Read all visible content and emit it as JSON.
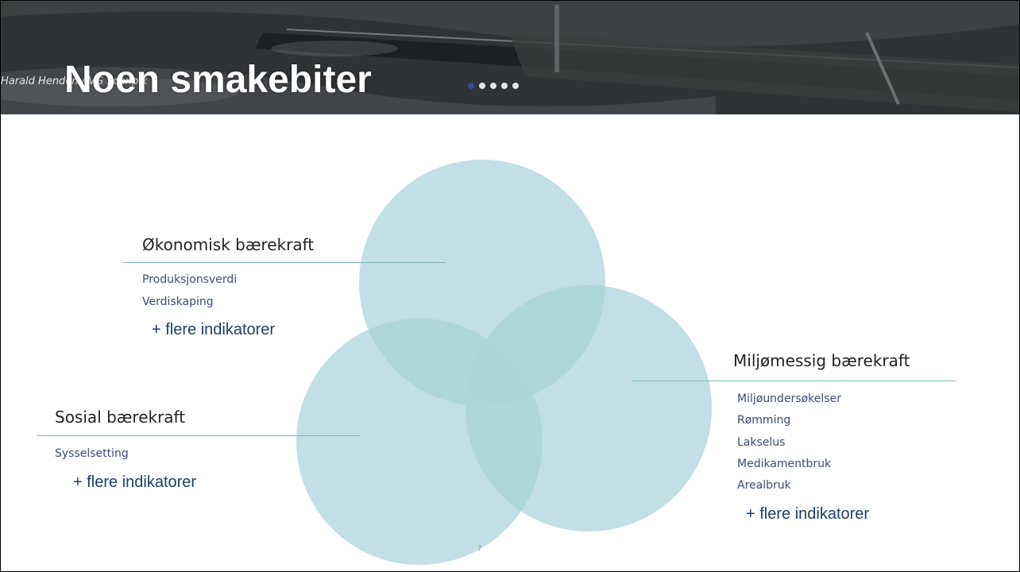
{
  "banner": {
    "photo_credit": "Harald Henden / VG Scanpix",
    "title": "Noen smakebiter",
    "pager_dots": 5,
    "active_dot": 0
  },
  "diagram": {
    "circle_color": "#a9d3da",
    "economic": {
      "heading": "Økonomisk bærekraft",
      "indicators": [
        "Produksjonsverdi",
        "Verdiskaping"
      ],
      "more": "+ flere indikatorer"
    },
    "social": {
      "heading": "Sosial bærekraft",
      "indicators": [
        "Sysselsetting"
      ],
      "more": "+ flere indikatorer"
    },
    "environmental": {
      "heading": "Miljømessig bærekraft",
      "indicators": [
        "Miljøundersøkelser",
        "Rømming",
        "Lakselus",
        "Medikamentbruk",
        "Arealbruk"
      ],
      "more": "+ flere indikatorer"
    }
  },
  "footer": {
    "page_number": "7"
  }
}
